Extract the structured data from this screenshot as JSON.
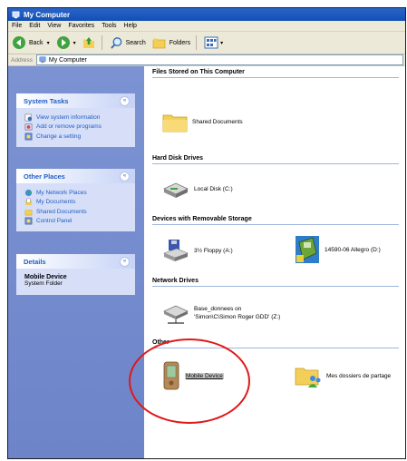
{
  "window": {
    "title": "My Computer"
  },
  "menu": [
    "File",
    "Edit",
    "View",
    "Favorites",
    "Tools",
    "Help"
  ],
  "toolbar": {
    "back_label": "Back",
    "search_label": "Search",
    "folders_label": "Folders"
  },
  "address": {
    "label": "Address",
    "value": "My Computer"
  },
  "sidebar": {
    "system_tasks": {
      "title": "System Tasks",
      "items": [
        "View system information",
        "Add or remove programs",
        "Change a setting"
      ]
    },
    "other_places": {
      "title": "Other Places",
      "items": [
        "My Network Places",
        "My Documents",
        "Shared Documents",
        "Control Panel"
      ]
    },
    "details": {
      "title": "Details",
      "name": "Mobile Device",
      "type": "System Folder"
    }
  },
  "groups": {
    "files_stored": {
      "title": "Files Stored on This Computer",
      "items": [
        "Shared Documents"
      ]
    },
    "hard_disks": {
      "title": "Hard Disk Drives",
      "items": [
        "Local Disk (C:)"
      ]
    },
    "removable": {
      "title": "Devices with Removable Storage",
      "items": [
        "3½ Floppy (A:)",
        "14590-06 Allegro (D:)"
      ]
    },
    "network": {
      "title": "Network Drives",
      "item_line1": "Base_donnees on",
      "item_line2": "'Simon\\C\\Simon Roger GDD' (Z:)"
    },
    "other": {
      "title": "Other",
      "items": [
        "Mobile Device",
        "Mes dossiers de partage"
      ]
    }
  },
  "colors": {
    "title_bar": "#1a56be",
    "sidebar": "#7389cd",
    "panel": "#d6dff7",
    "link": "#215dc6",
    "annotation_circle": "#e01818"
  }
}
